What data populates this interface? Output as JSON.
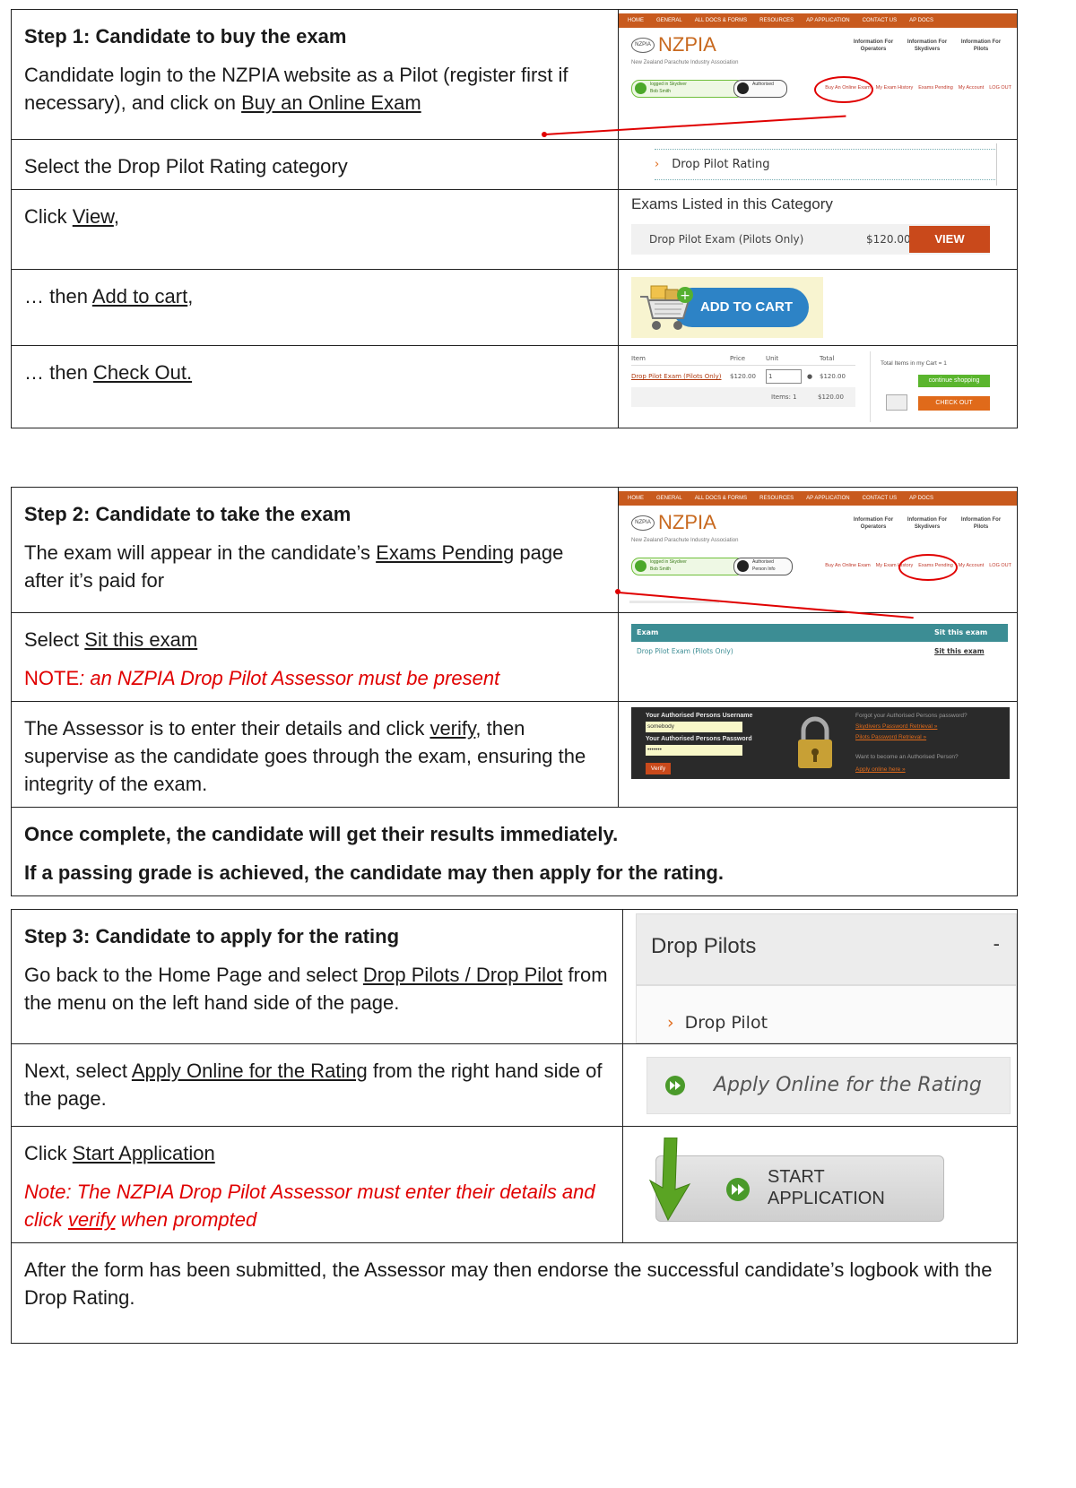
{
  "step1": {
    "title": "Step 1: Candidate to buy the exam",
    "intro_a": "Candidate login to the NZPIA website as a Pilot (register first if necessary), and click on ",
    "intro_link": "Buy an Online Exam",
    "row2": "Select the Drop Pilot Rating category",
    "row3_pre": "Click ",
    "row3_link": "View",
    "row3_post": ",",
    "row4_pre": "… then ",
    "row4_link": "Add to cart",
    "row4_post": ",",
    "row5_pre": "… then ",
    "row5_link": "Check Out."
  },
  "step2": {
    "title": "Step 2: Candidate to take the exam",
    "intro_a": "The exam will appear in the candidate’s ",
    "intro_link": "Exams Pending",
    "intro_b": " page after it’s paid for",
    "row2_link": "Sit this exam",
    "row2_pre": "Select ",
    "note_label": "NOTE",
    "note_text": ": an NZPIA Drop Pilot Assessor must be present",
    "row3_a": "The Assessor is to enter their details and click ",
    "row3_link": "verify",
    "row3_b": ", then supervise as the candidate goes through the exam, ensuring the integrity of the exam.",
    "footer1": "Once complete, the candidate will get their results immediately.",
    "footer2": "If a passing grade is achieved, the candidate may then apply for the rating."
  },
  "step3": {
    "title": "Step 3: Candidate to apply for the rating",
    "intro_a": "Go back to the Home Page and select ",
    "intro_link": "Drop Pilots / Drop Pilot",
    "intro_b": " from the menu on the left hand side of the page.",
    "row2_a": "Next, select ",
    "row2_link": "Apply Online for the Rating",
    "row2_b": " from the right hand side of the page.",
    "row3_pre": "Click ",
    "row3_link": "Start Application",
    "note_a": "Note: The NZPIA Drop Pilot Assessor must enter their details and click ",
    "note_link": "verify",
    "note_b": " when prompted",
    "footer": "After the form has been submitted, the Assessor may then endorse the successful candidate’s logbook with the Drop Rating."
  },
  "site": {
    "nav": [
      "HOME",
      "GENERAL",
      "ALL DOCS & FORMS",
      "RESOURCES",
      "AP APPLICATION",
      "CONTACT US",
      "AP DOCS"
    ],
    "logo_badge": "NZPIA",
    "logo": "NZPIA",
    "logo_sub": "New Zealand Parachute Industry Association",
    "info1": "Information For Operators",
    "info2": "Information For Skydivers",
    "info3": "Information For Pilots",
    "pill_green": "logged in Skydiver",
    "pill_green_name_1": "Bob Smith",
    "pill_green_name_2": "Bob Smith",
    "pill_dark": "Authorised",
    "pill_dark2": "Person Info",
    "acct_links_1": [
      "Buy An Online Exam",
      "My Exam History",
      "Exams Pending",
      "My Account",
      "LOG OUT"
    ],
    "acct_links_2": [
      "Buy An Online Exam",
      "My Exam History",
      "Exams Pending",
      "My Account",
      "LOG OUT"
    ]
  },
  "images": {
    "category": "Drop Pilot Rating",
    "exams_heading": "Exams Listed in this Category",
    "exam_name": "Drop Pilot Exam (Pilots Only)",
    "exam_price": "$120.00",
    "view_btn": "VIEW",
    "add_to_cart": "ADD TO CART",
    "cart_headers": [
      "Item",
      "Price",
      "Unit",
      "Total"
    ],
    "cart_item": "Drop Pilot Exam (Pilots Only)",
    "cart_price": "$120.00",
    "cart_unit": "1",
    "cart_total": "$120.00",
    "cart_items_label": "Items: 1",
    "cart_items_total": "$120.00",
    "cart_count": "Total Items in my Cart = 1",
    "continue_btn": "continue shopping",
    "checkout_btn": "CHECK OUT",
    "pending_col1": "Exam",
    "pending_col2": "Sit this exam",
    "pending_exam": "Drop Pilot Exam (Pilots Only)",
    "pending_link": "Sit this exam",
    "login_user_label": "Your Authorised Persons Username",
    "login_user_value": "somebody",
    "login_pass_label": "Your Authorised Persons Password",
    "login_pass_value": "•••••••",
    "verify_btn": "Verify",
    "forgot_q": "Forgot your Authorised Persons password?",
    "forgot_link1": "Skydivers Password Retrieval »",
    "forgot_link2": "Pilots Password Retrieval »",
    "become_q": "Want to become an Authorised Person?",
    "apply_link": "Apply online here »",
    "menu_title": "Drop Pilots",
    "menu_toggle": "-",
    "menu_item": "Drop Pilot",
    "apply_online": "Apply Online for the Rating",
    "start_line1": "START",
    "start_line2": "APPLICATION"
  }
}
